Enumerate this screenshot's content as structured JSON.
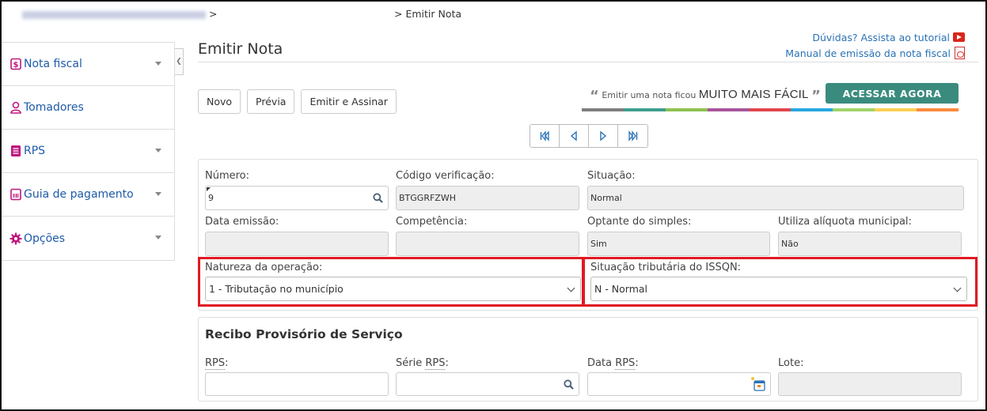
{
  "breadcrumb": {
    "sep": ">",
    "current": "> Emitir Nota"
  },
  "sidebar": {
    "items": [
      {
        "label": "Nota fiscal",
        "icon": "dollar-icon",
        "has_chevron": true
      },
      {
        "label": "Tomadores",
        "icon": "user-icon",
        "has_chevron": false
      },
      {
        "label": "RPS",
        "icon": "document-icon",
        "has_chevron": true
      },
      {
        "label": "Guia de pagamento",
        "icon": "barcode-icon",
        "has_chevron": true
      },
      {
        "label": "Opções",
        "icon": "gear-icon",
        "has_chevron": true
      }
    ]
  },
  "header": {
    "title": "Emitir Nota",
    "help_video": "Dúvidas? Assista ao tutorial",
    "help_manual": "Manual de emissão da nota fiscal"
  },
  "toolbar": {
    "new_label": "Novo",
    "preview_label": "Prévia",
    "issue_label": "Emitir e Assinar"
  },
  "promo": {
    "open_quote": "“",
    "text": "Emitir uma nota ficou",
    "highlight": "MUITO MAIS FÁCIL",
    "close_quote": "”",
    "cta": "ACESSAR AGORA",
    "bar_colors": [
      "#7d7d7d",
      "#3f9e8e",
      "#8cc152",
      "#a8559c",
      "#e0474c",
      "#27a7e0",
      "#a0d468",
      "#ffce54",
      "#fc8a3c"
    ]
  },
  "form": {
    "numero_label": "Número:",
    "numero_value": "9",
    "codigo_label": "Código verificação:",
    "codigo_value": "BTGGRFZWH",
    "situacao_label": "Situação:",
    "situacao_value": "Normal",
    "data_emissao_label": "Data emissão:",
    "data_emissao_value": "",
    "competencia_label": "Competência:",
    "competencia_value": "",
    "optante_label": "Optante do simples:",
    "optante_value": "Sim",
    "aliquota_label": "Utiliza alíquota municipal:",
    "aliquota_value": "Não",
    "natureza_label": "Natureza da operação:",
    "natureza_value": "1 - Tributação no município",
    "situacao_trib_label": "Situação tributária do ISSQN:",
    "situacao_trib_value": "N - Normal"
  },
  "rps": {
    "title": "Recibo Provisório de Serviço",
    "rps_abbr": "RPS",
    "rps_suffix": ":",
    "serie_prefix": "Série ",
    "serie_abbr": "RPS",
    "serie_suffix": ":",
    "data_prefix": "Data ",
    "data_abbr": "RPS",
    "data_suffix": ":",
    "lote_label": "Lote:"
  },
  "colors": {
    "accent": "#1e5aa8",
    "cta": "#3a8b7e",
    "highlight_border": "#e01a22"
  }
}
